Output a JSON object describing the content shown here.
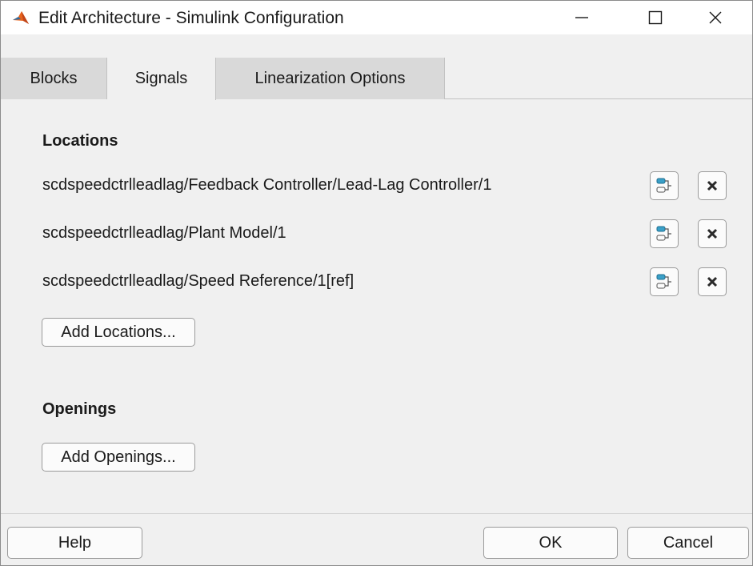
{
  "window": {
    "title": "Edit Architecture - Simulink Configuration",
    "app_icon": "matlab-icon"
  },
  "tabs": [
    {
      "label": "Blocks",
      "active": false
    },
    {
      "label": "Signals",
      "active": true
    },
    {
      "label": "Linearization Options",
      "active": false
    }
  ],
  "locations": {
    "heading": "Locations",
    "items": [
      {
        "path": "scdspeedctrlleadlag/Feedback Controller/Lead-Lag Controller/1"
      },
      {
        "path": "scdspeedctrlleadlag/Plant Model/1"
      },
      {
        "path": "scdspeedctrlleadlag/Speed Reference/1[ref]"
      }
    ],
    "add_label": "Add Locations..."
  },
  "openings": {
    "heading": "Openings",
    "add_label": "Add Openings..."
  },
  "footer": {
    "help_label": "Help",
    "ok_label": "OK",
    "cancel_label": "Cancel"
  },
  "colors": {
    "window_bg": "#f0f0f0",
    "inactive_tab": "#d9d9d9",
    "highlight_icon": "#3aa0c8"
  }
}
